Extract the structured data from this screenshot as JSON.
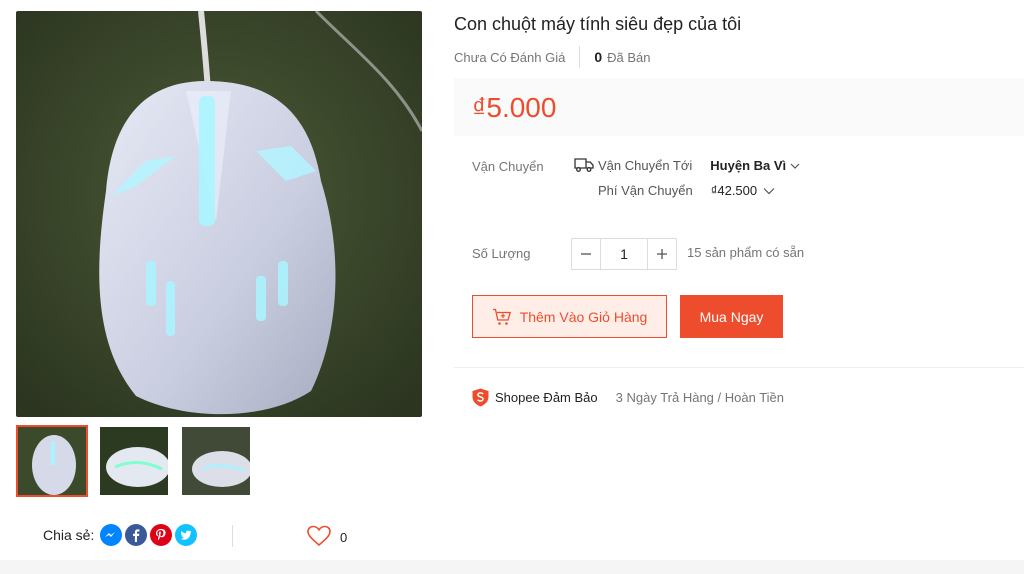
{
  "product": {
    "title": "Con chuột máy tính siêu đẹp của tôi",
    "rating_text": "Chưa Có Đánh Giá",
    "sold_count": "0",
    "sold_label": "Đã Bán",
    "price": "₫5.000"
  },
  "shipping": {
    "label": "Vận Chuyển",
    "to_label": "Vận Chuyển Tới",
    "to_value": "Huyện Ba Vì",
    "fee_label": "Phí Vận Chuyển",
    "fee_value": "₫42.500"
  },
  "quantity": {
    "label": "Số Lượng",
    "value": "1",
    "stock": "15 sản phẩm có sẵn"
  },
  "actions": {
    "add_to_cart": "Thêm Vào Giỏ Hàng",
    "buy_now": "Mua Ngay"
  },
  "guarantee": {
    "brand": "Shopee Đảm Bảo",
    "text": "3 Ngày Trả Hàng / Hoàn Tiền"
  },
  "share": {
    "label": "Chia sẻ:",
    "icons": [
      "messenger-icon",
      "facebook-icon",
      "pinterest-icon",
      "twitter-icon"
    ]
  },
  "favorite": {
    "count": "0"
  },
  "colors": {
    "accent": "#ee4d2d",
    "messenger": "#0084ff",
    "facebook": "#3b5999",
    "pinterest": "#de0217",
    "twitter": "#10c2ff"
  }
}
